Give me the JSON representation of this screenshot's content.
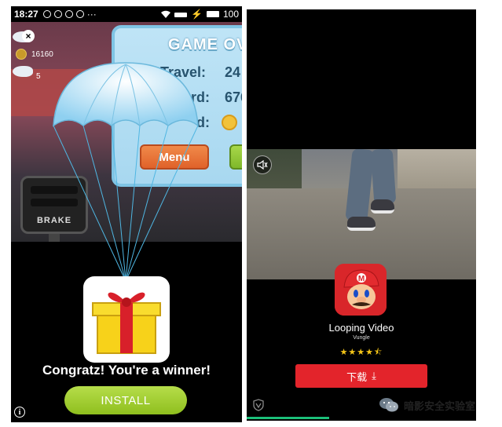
{
  "left_screen": {
    "status_bar": {
      "time": "18:27",
      "extra": "···",
      "battery": "100"
    },
    "game": {
      "score": "16160",
      "small_count": "5",
      "panel_title": "GAME OV",
      "travel_label": "Travel:",
      "travel_value": "24",
      "record_label": "ord:",
      "record_value": "676",
      "gold_label": "d:",
      "menu_label": "Menu",
      "brake_label": "BRAKE"
    },
    "ad": {
      "congrats_text": "Congratz! You're a winner!",
      "install_label": "INSTALL",
      "info_label": "i"
    }
  },
  "right_screen": {
    "app_title": "Looping Video",
    "publisher": "Vungle",
    "rating": 4.5,
    "rating_stars": "★★★★⯪",
    "download_label": "下载",
    "download_icon": "⤓",
    "progress": 0.36,
    "accent_color": "#e3242b"
  },
  "watermark": {
    "text": "暗影安全实验室"
  }
}
